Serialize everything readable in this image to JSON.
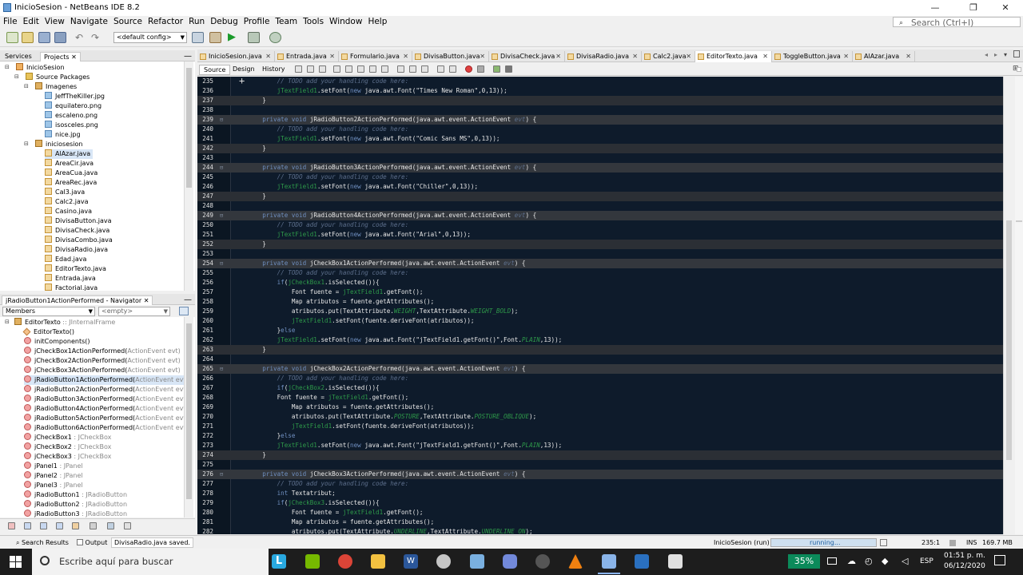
{
  "window": {
    "title": "InicioSesion - NetBeans IDE 8.2",
    "minimize": "—",
    "maximize": "❐",
    "close": "✕"
  },
  "menu": [
    "File",
    "Edit",
    "View",
    "Navigate",
    "Source",
    "Refactor",
    "Run",
    "Debug",
    "Profile",
    "Team",
    "Tools",
    "Window",
    "Help"
  ],
  "search": {
    "placeholder": "Search (Ctrl+I)",
    "icon": "magnifier"
  },
  "toolbar": {
    "config": "<default config>"
  },
  "projects_panel": {
    "tabs": [
      "Services",
      "Projects"
    ],
    "tree": [
      {
        "label": "InicioSesion",
        "icon": "project"
      },
      {
        "label": "Source Packages",
        "icon": "folder"
      },
      {
        "label": "Imagenes",
        "icon": "package"
      },
      {
        "label": "JeffTheKiller.jpg",
        "icon": "image"
      },
      {
        "label": "equilatero.png",
        "icon": "image"
      },
      {
        "label": "escaleno.png",
        "icon": "image"
      },
      {
        "label": "isosceles.png",
        "icon": "image"
      },
      {
        "label": "nice.jpg",
        "icon": "image"
      },
      {
        "label": "iniciosesion",
        "icon": "package"
      },
      {
        "label": "AlAzar.java",
        "icon": "java",
        "selected": true
      },
      {
        "label": "AreaCir.java",
        "icon": "java"
      },
      {
        "label": "AreaCua.java",
        "icon": "java"
      },
      {
        "label": "AreaRec.java",
        "icon": "java"
      },
      {
        "label": "Cal3.java",
        "icon": "java"
      },
      {
        "label": "Calc2.java",
        "icon": "java"
      },
      {
        "label": "Casino.java",
        "icon": "java"
      },
      {
        "label": "DivisaButton.java",
        "icon": "java"
      },
      {
        "label": "DivisaCheck.java",
        "icon": "java"
      },
      {
        "label": "DivisaCombo.java",
        "icon": "java"
      },
      {
        "label": "DivisaRadio.java",
        "icon": "java"
      },
      {
        "label": "Edad.java",
        "icon": "java"
      },
      {
        "label": "EditorTexto.java",
        "icon": "java"
      },
      {
        "label": "Entrada.java",
        "icon": "java"
      },
      {
        "label": "Factorial.java",
        "icon": "java"
      }
    ]
  },
  "navigator": {
    "title": "jRadioButton1ActionPerformed - Navigator",
    "filter": "Members",
    "filter_value": "<empty>",
    "items": [
      {
        "name": "EditorTexto",
        "type": " :: JInternalFrame",
        "kind": "class"
      },
      {
        "name": "EditorTexto()",
        "type": "",
        "kind": "ctor"
      },
      {
        "name": "initComponents()",
        "type": "",
        "kind": "method"
      },
      {
        "name": "jCheckBox1ActionPerformed(",
        "type": "ActionEvent evt)",
        "kind": "method"
      },
      {
        "name": "jCheckBox2ActionPerformed(",
        "type": "ActionEvent evt)",
        "kind": "method"
      },
      {
        "name": "jCheckBox3ActionPerformed(",
        "type": "ActionEvent evt)",
        "kind": "method"
      },
      {
        "name": "jRadioButton1ActionPerformed(",
        "type": "ActionEvent evt)",
        "kind": "method",
        "selected": true
      },
      {
        "name": "jRadioButton2ActionPerformed(",
        "type": "ActionEvent evt)",
        "kind": "method"
      },
      {
        "name": "jRadioButton3ActionPerformed(",
        "type": "ActionEvent evt)",
        "kind": "method"
      },
      {
        "name": "jRadioButton4ActionPerformed(",
        "type": "ActionEvent evt)",
        "kind": "method"
      },
      {
        "name": "jRadioButton5ActionPerformed(",
        "type": "ActionEvent evt)",
        "kind": "method"
      },
      {
        "name": "jRadioButton6ActionPerformed(",
        "type": "ActionEvent evt)",
        "kind": "method"
      },
      {
        "name": "jCheckBox1",
        "type": " : JCheckBox",
        "kind": "field"
      },
      {
        "name": "jCheckBox2",
        "type": " : JCheckBox",
        "kind": "field"
      },
      {
        "name": "jCheckBox3",
        "type": " : JCheckBox",
        "kind": "field"
      },
      {
        "name": "jPanel1",
        "type": " : JPanel",
        "kind": "field"
      },
      {
        "name": "jPanel2",
        "type": " : JPanel",
        "kind": "field"
      },
      {
        "name": "jPanel3",
        "type": " : JPanel",
        "kind": "field"
      },
      {
        "name": "jRadioButton1",
        "type": " : JRadioButton",
        "kind": "field"
      },
      {
        "name": "jRadioButton2",
        "type": " : JRadioButton",
        "kind": "field"
      },
      {
        "name": "jRadioButton3",
        "type": " : JRadioButton",
        "kind": "field"
      }
    ]
  },
  "editor": {
    "tabs": [
      "InicioSesion.java",
      "Entrada.java",
      "Formulario.java",
      "DivisaButton.java",
      "DivisaCheck.java",
      "DivisaRadio.java",
      "Calc2.java",
      "EditorTexto.java",
      "ToggleButton.java",
      "AlAzar.java"
    ],
    "active_tab": "EditorTexto.java",
    "views": [
      "Source",
      "Design",
      "History"
    ],
    "lines": [
      {
        "n": "235",
        "t": "        <c>// TODO add your handling code here:</c>"
      },
      {
        "n": "236",
        "t": "        <f>jTextField1</f>.setFont(<k>new</k> java.awt.Font(<s>\"Times New Roman\"</s>,0,13));"
      },
      {
        "n": "237",
        "t": "    }",
        "cls": "mend"
      },
      {
        "n": "238",
        "t": ""
      },
      {
        "n": "239",
        "t": "    <k>private void</k> jRadioButton2ActionPerformed(java.awt.event.ActionEvent <c>evt</c>) {",
        "cls": "mhead",
        "fold": true
      },
      {
        "n": "240",
        "t": "        <c>// TODO add your handling code here:</c>"
      },
      {
        "n": "241",
        "t": "        <f>jTextField1</f>.setFont(<k>new</k> java.awt.Font(<s>\"Comic Sans MS\"</s>,0,13));"
      },
      {
        "n": "242",
        "t": "    }",
        "cls": "mend"
      },
      {
        "n": "243",
        "t": ""
      },
      {
        "n": "244",
        "t": "    <k>private void</k> jRadioButton3ActionPerformed(java.awt.event.ActionEvent <c>evt</c>) {",
        "cls": "mhead",
        "fold": true
      },
      {
        "n": "245",
        "t": "        <c>// TODO add your handling code here:</c>"
      },
      {
        "n": "246",
        "t": "        <f>jTextField1</f>.setFont(<k>new</k> java.awt.Font(<s>\"Chiller\"</s>,0,13));"
      },
      {
        "n": "247",
        "t": "    }",
        "cls": "mend"
      },
      {
        "n": "248",
        "t": ""
      },
      {
        "n": "249",
        "t": "    <k>private void</k> jRadioButton4ActionPerformed(java.awt.event.ActionEvent <c>evt</c>) {",
        "cls": "mhead",
        "fold": true
      },
      {
        "n": "250",
        "t": "        <c>// TODO add your handling code here:</c>"
      },
      {
        "n": "251",
        "t": "        <f>jTextField1</f>.setFont(<k>new</k> java.awt.Font(<s>\"Arial\"</s>,0,13));"
      },
      {
        "n": "252",
        "t": "    }",
        "cls": "mend"
      },
      {
        "n": "253",
        "t": ""
      },
      {
        "n": "254",
        "t": "    <k>private void</k> jCheckBox1ActionPerformed(java.awt.event.ActionEvent <c>evt</c>) {",
        "cls": "mhead",
        "fold": true
      },
      {
        "n": "255",
        "t": "        <c>// TODO add your handling code here:</c>"
      },
      {
        "n": "256",
        "t": "        <k>if</k>(<f>jCheckBox1</f>.isSelected()){"
      },
      {
        "n": "257",
        "t": "            Font fuente = <f>jTextField1</f>.getFont();"
      },
      {
        "n": "258",
        "t": "            Map atributos = fuente.getAttributes();"
      },
      {
        "n": "259",
        "t": "            atributos.put(TextAttribute.<st>WEIGHT</st>,TextAttribute.<st>WEIGHT_BOLD</st>);"
      },
      {
        "n": "260",
        "t": "            <f>jTextField1</f>.setFont(fuente.deriveFont(atributos));"
      },
      {
        "n": "261",
        "t": "        }<k>else</k>"
      },
      {
        "n": "262",
        "t": "        <f>jTextField1</f>.setFont(<k>new</k> java.awt.Font(<s>\"jTextField1.getFont()\"</s>,Font.<st>PLAIN</st>,13));"
      },
      {
        "n": "263",
        "t": "    }",
        "cls": "mend"
      },
      {
        "n": "264",
        "t": ""
      },
      {
        "n": "265",
        "t": "    <k>private void</k> jCheckBox2ActionPerformed(java.awt.event.ActionEvent <c>evt</c>) {",
        "cls": "mhead",
        "fold": true
      },
      {
        "n": "266",
        "t": "        <c>// TODO add your handling code here:</c>"
      },
      {
        "n": "267",
        "t": "        <k>if</k>(<f>jCheckBox2</f>.isSelected()){"
      },
      {
        "n": "268",
        "t": "        Font fuente = <f>jTextField1</f>.getFont();"
      },
      {
        "n": "269",
        "t": "            Map atributos = fuente.getAttributes();"
      },
      {
        "n": "270",
        "t": "            atributos.put(TextAttribute.<st>POSTURE</st>,TextAttribute.<st>POSTURE_OBLIQUE</st>);"
      },
      {
        "n": "271",
        "t": "            <f>jTextField1</f>.setFont(fuente.deriveFont(atributos));"
      },
      {
        "n": "272",
        "t": "        }<k>else</k>"
      },
      {
        "n": "273",
        "t": "        <f>jTextField1</f>.setFont(<k>new</k> java.awt.Font(<s>\"jTextField1.getFont()\"</s>,Font.<st>PLAIN</st>,13));"
      },
      {
        "n": "274",
        "t": "    }",
        "cls": "mend"
      },
      {
        "n": "275",
        "t": ""
      },
      {
        "n": "276",
        "t": "    <k>private void</k> jCheckBox3ActionPerformed(java.awt.event.ActionEvent <c>evt</c>) {",
        "cls": "mhead",
        "fold": true
      },
      {
        "n": "277",
        "t": "        <c>// TODO add your handling code here:</c>"
      },
      {
        "n": "278",
        "t": "        <k>int</k> Textatribut;"
      },
      {
        "n": "279",
        "t": "        <k>if</k>(<f>jCheckBox3</f>.isSelected()){"
      },
      {
        "n": "280",
        "t": "            Font fuente = <f>jTextField1</f>.getFont();"
      },
      {
        "n": "281",
        "t": "            Map atributos = fuente.getAttributes();"
      },
      {
        "n": "282",
        "t": "            atributos.put(TextAttribute.<st>UNDERLINE</st>,TextAttribute.<st>UNDERLINE_ON</st>);"
      }
    ]
  },
  "status": {
    "search_results": "Search Results",
    "output": "Output",
    "message": "DivisaRadio.java saved.",
    "run_task": "InicioSesion (run)",
    "progress_text": "running...",
    "position": "235:1",
    "mode": "INS",
    "memory": "169.7 MB"
  },
  "taskbar": {
    "search_placeholder": "Escribe aquí para buscar",
    "battery": "35%",
    "lang": "ESP",
    "time": "01:51 p. m.",
    "date": "06/12/2020"
  }
}
